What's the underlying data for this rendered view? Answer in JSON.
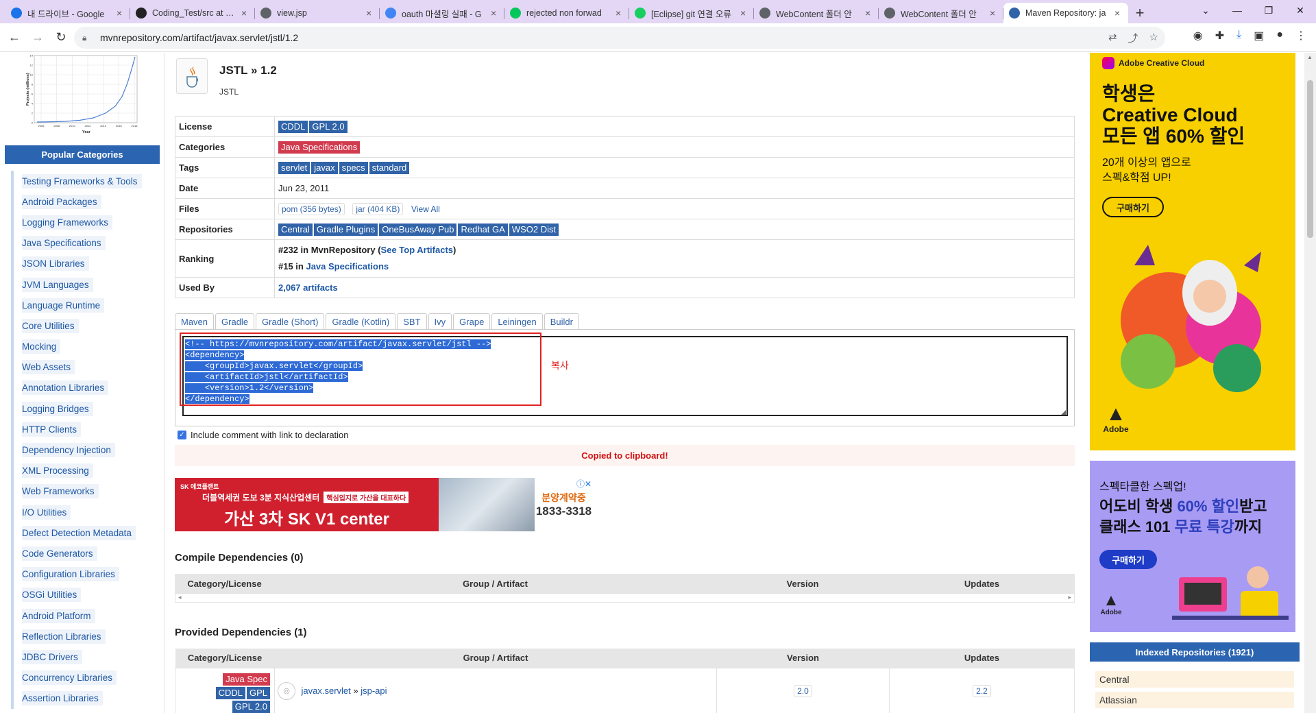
{
  "browser": {
    "tabs": [
      {
        "label": "내 드라이브 - Google",
        "fav": "#1a73e8"
      },
      {
        "label": "Coding_Test/src at cry",
        "fav": "#222222"
      },
      {
        "label": "view.jsp",
        "fav": "#5f6368"
      },
      {
        "label": "oauth 마셜링 실패 - G",
        "fav": "#4285f4"
      },
      {
        "label": "rejected non forwad",
        "fav": "#03c75a"
      },
      {
        "label": "[Eclipse] git 연결 오류",
        "fav": "#19ce60"
      },
      {
        "label": "WebContent 폴더 안",
        "fav": "#5f6368"
      },
      {
        "label": "WebContent 폴더 안",
        "fav": "#5f6368"
      },
      {
        "label": "Maven Repository: ja",
        "fav": "#3063a8"
      }
    ],
    "url": "mvnrepository.com/artifact/javax.servlet/jstl/1.2"
  },
  "sidebar": {
    "popular_title": "Popular Categories",
    "categories": [
      "Testing Frameworks & Tools",
      "Android Packages",
      "Logging Frameworks",
      "Java Specifications",
      "JSON Libraries",
      "JVM Languages",
      "Language Runtime",
      "Core Utilities",
      "Mocking",
      "Web Assets",
      "Annotation Libraries",
      "Logging Bridges",
      "HTTP Clients",
      "Dependency Injection",
      "XML Processing",
      "Web Frameworks",
      "I/O Utilities",
      "Defect Detection Metadata",
      "Code Generators",
      "Configuration Libraries",
      "OSGi Utilities",
      "Android Platform",
      "Reflection Libraries",
      "JDBC Drivers",
      "Concurrency Libraries",
      "Assertion Libraries"
    ],
    "chart": {
      "ylabel": "Projects (millions)",
      "xlabel": "Year",
      "xticks": [
        "2006",
        "2008",
        "2010",
        "2012",
        "2014",
        "2016",
        "2018"
      ],
      "yticks": [
        "0",
        "2",
        "4",
        "6",
        "8",
        "10",
        "12",
        "14"
      ]
    }
  },
  "artifact": {
    "title": "JSTL » 1.2",
    "subtitle": "JSTL",
    "license_label": "License",
    "licenses": [
      "CDDL",
      "GPL 2.0"
    ],
    "categories_label": "Categories",
    "categories": [
      "Java Specifications"
    ],
    "tags_label": "Tags",
    "tags": [
      "servlet",
      "javax",
      "specs",
      "standard"
    ],
    "date_label": "Date",
    "date": "Jun 23, 2011",
    "files_label": "Files",
    "file_pom": "pom (356 bytes)",
    "file_jar": "jar (404 KB)",
    "view_all": "View All",
    "repos_label": "Repositories",
    "repositories": [
      "Central",
      "Gradle Plugins",
      "OneBusAway Pub",
      "Redhat GA",
      "WSO2 Dist"
    ],
    "ranking_label": "Ranking",
    "rank1_prefix": "#232 in MvnRepository (",
    "rank1_link": "See Top Artifacts",
    "rank1_suffix": ")",
    "rank2_prefix": "#15 in ",
    "rank2_link": "Java Specifications",
    "usedby_label": "Used By",
    "usedby": "2,067 artifacts"
  },
  "build_tabs": [
    "Maven",
    "Gradle",
    "Gradle (Short)",
    "Gradle (Kotlin)",
    "SBT",
    "Ivy",
    "Grape",
    "Leiningen",
    "Buildr"
  ],
  "snippet": {
    "lines": [
      "<!-- https://mvnrepository.com/artifact/javax.servlet/jstl -->",
      "<dependency>",
      "    <groupId>javax.servlet</groupId>",
      "    <artifactId>jstl</artifactId>",
      "    <version>1.2</version>",
      "</dependency>"
    ],
    "annotation": "복사",
    "include_comment": "Include comment with link to declaration",
    "copied_msg": "Copied to clipboard!"
  },
  "ad_banner": {
    "brand": "SK 에코플랜트",
    "line1": "더블역세권 도보 3분 지식산업센터",
    "tagline": "핵심입지로 가산을 대표하다",
    "headline": "가산 3차 SK V1 center",
    "contact_label": "분양계약중",
    "phone": "1833-3318"
  },
  "compile_deps": {
    "title": "Compile Dependencies (0)",
    "headers": [
      "Category/License",
      "Group / Artifact",
      "Version",
      "Updates"
    ]
  },
  "provided_deps": {
    "title": "Provided Dependencies (1)",
    "headers": [
      "Category/License",
      "Group / Artifact",
      "Version",
      "Updates"
    ],
    "row": {
      "badges_red": [
        "Java Spec"
      ],
      "badges_blue": [
        "CDDL",
        "GPL",
        "GPL 2.0"
      ],
      "group": "javax.servlet",
      "sep": "»",
      "artifact": "jsp-api",
      "version": "2.0",
      "update": "2.2"
    }
  },
  "ads_right": {
    "ad1_brand": "Adobe Creative Cloud",
    "ad1_h1": "학생은",
    "ad1_h2": "Creative Cloud",
    "ad1_h3": "모든 앱 60% 할인",
    "ad1_sub1": "20개 이상의 앱으로",
    "ad1_sub2": "스펙&학점 UP!",
    "ad1_cta": "구매하기",
    "ad1_logo": "Adobe",
    "ad2_l1": "스펙타클한 스펙업!",
    "ad2_l2a": "어도비 학생 ",
    "ad2_l2b": "60% 할인",
    "ad2_l2c": "받고",
    "ad2_l3a": "클래스 101 ",
    "ad2_l3b": "무료 특강",
    "ad2_l3c": "까지",
    "ad2_cta": "구매하기",
    "ad2_logo": "Adobe",
    "indexed_title": "Indexed Repositories (1921)",
    "repos": [
      "Central",
      "Atlassian"
    ]
  },
  "colors": {
    "brand_blue": "#2b64b0",
    "badge_red": "#d23a4e",
    "ad_yellow": "#f8d000",
    "ad_purple": "#a89bf4"
  }
}
